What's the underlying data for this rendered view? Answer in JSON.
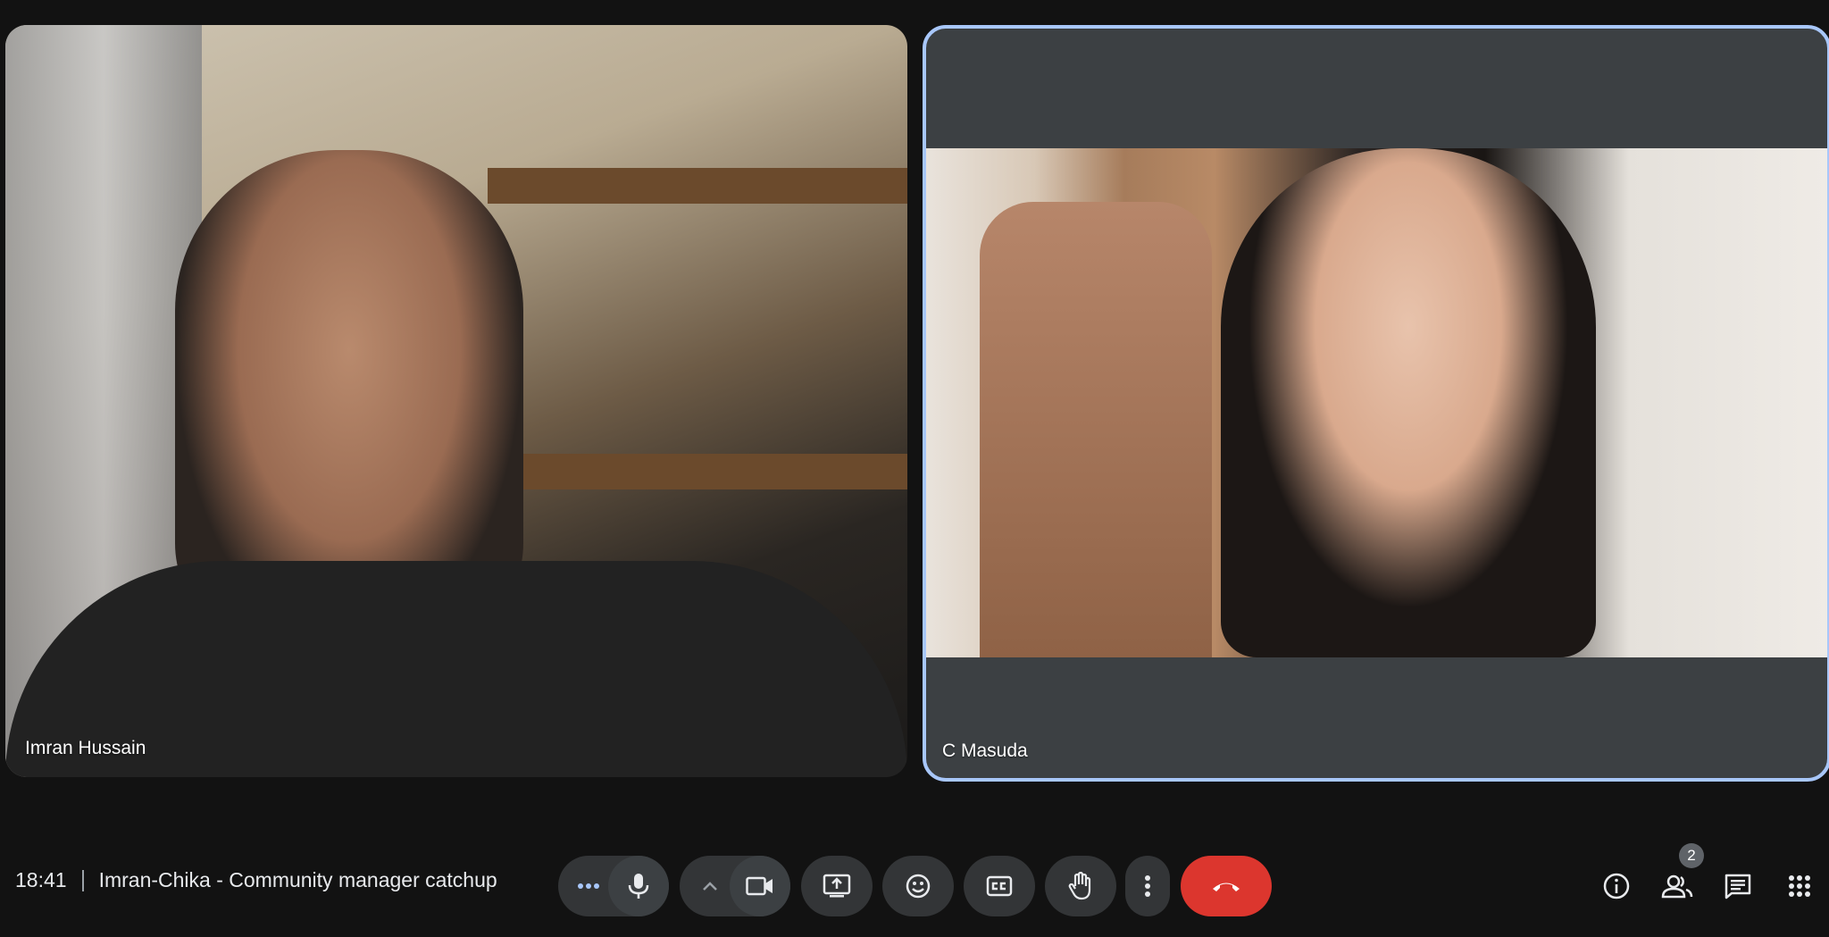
{
  "participants": [
    {
      "name": "Imran Hussain"
    },
    {
      "name": "C Masuda",
      "active_speaker": true
    }
  ],
  "meeting": {
    "time": "18:41",
    "title": "Imran-Chika - Community manager catchup"
  },
  "controls": {
    "participant_count": "2",
    "leave_color": "#dc362e",
    "active_border_color": "#a8c7fa"
  },
  "icons": [
    "more-options-icon",
    "microphone-icon",
    "chevron-up-icon",
    "camera-icon",
    "present-screen-icon",
    "emoji-icon",
    "captions-icon",
    "raise-hand-icon",
    "more-vert-icon",
    "call-end-icon",
    "info-icon",
    "people-icon",
    "chat-icon",
    "apps-icon"
  ]
}
